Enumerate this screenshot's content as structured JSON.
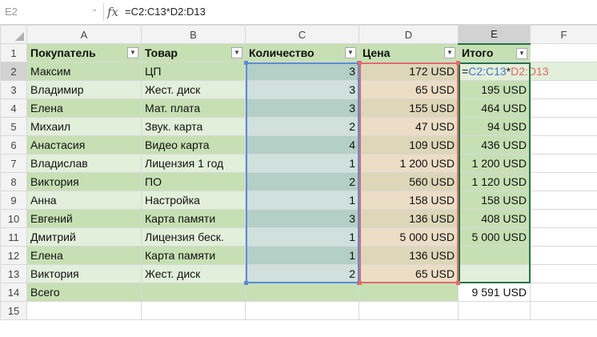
{
  "formula_bar": {
    "name_box": "E2",
    "fx_label": "fx",
    "formula": "=C2:C13*D2:D13"
  },
  "columns": [
    "A",
    "B",
    "C",
    "D",
    "E",
    "F"
  ],
  "table_headers": [
    "Покупатель",
    "Товар",
    "Количество",
    "Цена",
    "Итого"
  ],
  "rows": [
    {
      "num": "2",
      "buyer": "Максим",
      "product": "ЦП",
      "qty": "3",
      "price": "172 USD",
      "total": ""
    },
    {
      "num": "3",
      "buyer": "Владимир",
      "product": "Жест. диск",
      "qty": "3",
      "price": "65 USD",
      "total": "195 USD"
    },
    {
      "num": "4",
      "buyer": "Елена",
      "product": "Мат. плата",
      "qty": "3",
      "price": "155 USD",
      "total": "464 USD"
    },
    {
      "num": "5",
      "buyer": "Михаил",
      "product": "Звук. карта",
      "qty": "2",
      "price": "47 USD",
      "total": "94 USD"
    },
    {
      "num": "6",
      "buyer": "Анастасия",
      "product": "Видео карта",
      "qty": "4",
      "price": "109 USD",
      "total": "436 USD"
    },
    {
      "num": "7",
      "buyer": "Владислав",
      "product": "Лицензия 1 год",
      "qty": "1",
      "price": "1 200 USD",
      "total": "1 200 USD"
    },
    {
      "num": "8",
      "buyer": "Виктория",
      "product": "ПО",
      "qty": "2",
      "price": "560 USD",
      "total": "1 120 USD"
    },
    {
      "num": "9",
      "buyer": "Анна",
      "product": "Настройка",
      "qty": "1",
      "price": "158 USD",
      "total": "158 USD"
    },
    {
      "num": "10",
      "buyer": "Евгений",
      "product": "Карта памяти",
      "qty": "3",
      "price": "136 USD",
      "total": "408 USD"
    },
    {
      "num": "11",
      "buyer": "Дмитрий",
      "product": "Лицензия беск.",
      "qty": "1",
      "price": "5 000 USD",
      "total": "5 000 USD"
    },
    {
      "num": "12",
      "buyer": "Елена",
      "product": "Карта памяти",
      "qty": "1",
      "price": "136 USD",
      "total": ""
    },
    {
      "num": "13",
      "buyer": "Виктория",
      "product": "Жест. диск",
      "qty": "2",
      "price": "65 USD",
      "total": ""
    }
  ],
  "editing_formula": {
    "eq": "=",
    "ref1": "C2:C13",
    "op": "*",
    "ref2": "D2:D13"
  },
  "total_row": {
    "num": "14",
    "label": "Всего",
    "value": "9 591 USD"
  },
  "empty_row": {
    "num": "15"
  },
  "header_row_num": "1",
  "colors": {
    "header_green": "#c6e0b4",
    "band_light": "#e2efda",
    "ref_c_border": "#5b8dd6",
    "ref_d_border": "#e06b6b",
    "selection": "#217346"
  }
}
